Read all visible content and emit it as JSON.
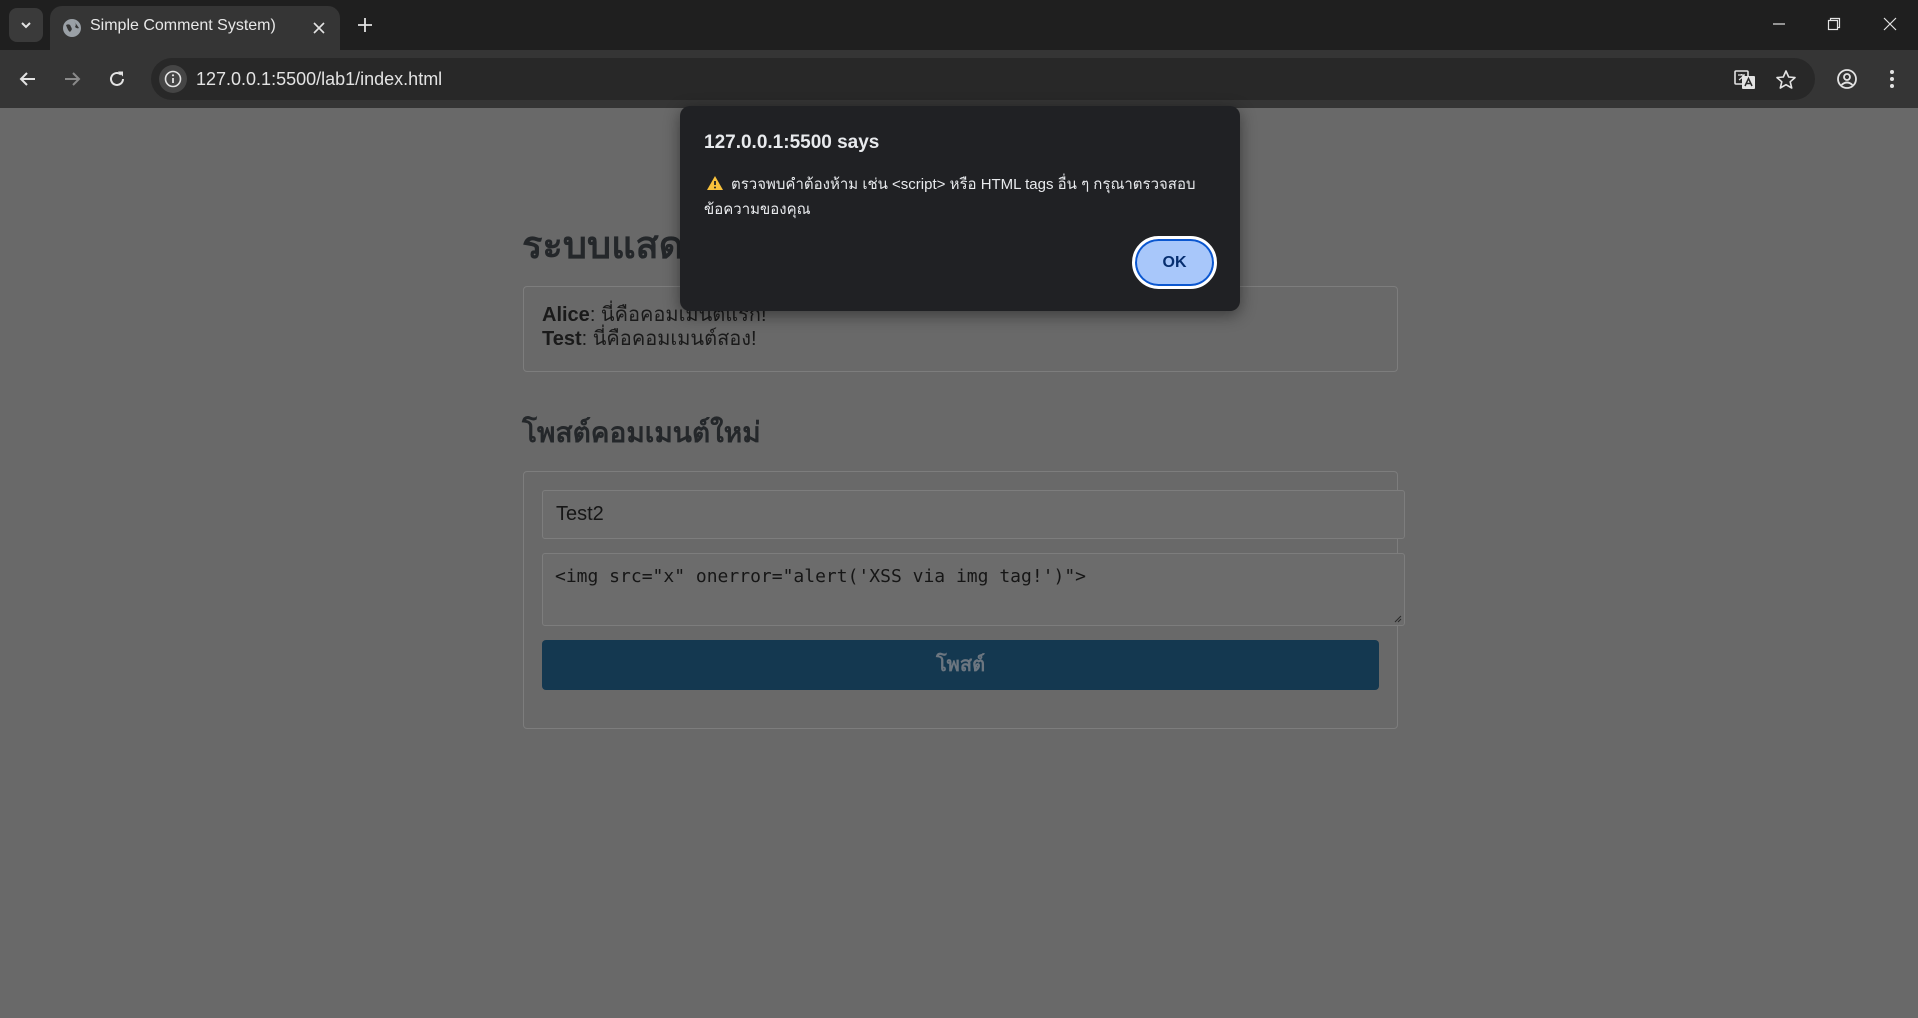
{
  "browser": {
    "tab_title": "Simple Comment System)",
    "url": "127.0.0.1:5500/lab1/index.html"
  },
  "page": {
    "heading": "ระบบแสดงความคิดเห็น",
    "comments": [
      {
        "author": "Alice",
        "text": ": นี่คือคอมเมนต์แรก!"
      },
      {
        "author": "Test",
        "text": ": นี่คือคอมเมนต์สอง!"
      }
    ],
    "form_heading": "โพสต์คอมเมนต์ใหม่",
    "name_value": "Test2",
    "message_value": "<img src=\"x\" onerror=\"alert('XSS via img tag!')\">",
    "post_label": "โพสต์",
    "accent_color": "#143850"
  },
  "dialog": {
    "title": "127.0.0.1:5500 says",
    "message": "ตรวจพบคำต้องห้าม เช่น <script> หรือ HTML tags อื่น ๆ กรุณาตรวจสอบข้อความของคุณ",
    "ok_label": "OK"
  }
}
